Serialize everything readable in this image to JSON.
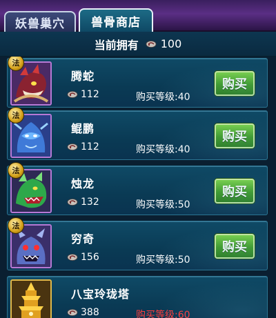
{
  "tabs": [
    {
      "label": "妖兽巢穴",
      "active": false
    },
    {
      "label": "兽骨商店",
      "active": true
    }
  ],
  "owned": {
    "label": "当前拥有",
    "value": "100",
    "icon": "bone-icon"
  },
  "items": [
    {
      "name": "腾蛇",
      "badge": "法",
      "price": "112",
      "level": "购买等级:40",
      "level_red": false,
      "buy_label": "购买"
    },
    {
      "name": "鲲鹏",
      "badge": "法",
      "price": "112",
      "level": "购买等级:40",
      "level_red": false,
      "buy_label": "购买"
    },
    {
      "name": "烛龙",
      "badge": "法",
      "price": "132",
      "level": "购买等级:50",
      "level_red": false,
      "buy_label": "购买"
    },
    {
      "name": "穷奇",
      "badge": "法",
      "price": "156",
      "level": "购买等级:50",
      "level_red": false,
      "buy_label": "购买"
    },
    {
      "name": "八宝玲珑塔",
      "badge": "",
      "price": "388",
      "level": "购买等级:60",
      "level_red": true,
      "buy_label": ""
    }
  ],
  "colors": {
    "accent_green": "#3f9a22",
    "level_red": "#ff3c3c",
    "row_bg": "#0f4a66"
  }
}
